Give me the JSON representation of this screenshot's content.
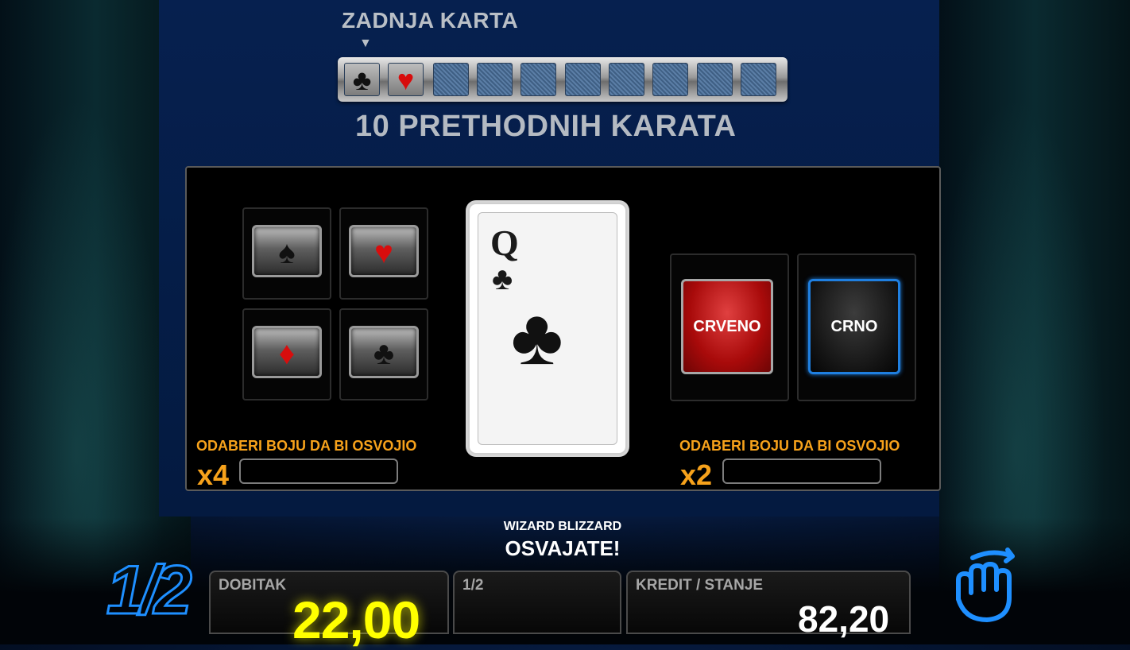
{
  "header": {
    "last_card_label": "ZADNJA KARTA",
    "arrow": "▼",
    "prev_cards_label": "10 PRETHODNIH KARATA"
  },
  "history": [
    {
      "state": "filled",
      "suit": "clubs",
      "glyph": "♣",
      "color": "#111111"
    },
    {
      "state": "filled",
      "suit": "hearts",
      "glyph": "♥",
      "color": "#d80d0d"
    },
    {
      "state": "empty"
    },
    {
      "state": "empty"
    },
    {
      "state": "empty"
    },
    {
      "state": "empty"
    },
    {
      "state": "empty"
    },
    {
      "state": "empty"
    },
    {
      "state": "empty"
    },
    {
      "state": "empty"
    }
  ],
  "suit_buttons": [
    {
      "name": "spade",
      "glyph": "♠",
      "color": "black"
    },
    {
      "name": "heart",
      "glyph": "♥",
      "color": "red"
    },
    {
      "name": "diamond",
      "glyph": "♦",
      "color": "red"
    },
    {
      "name": "club",
      "glyph": "♣",
      "color": "black"
    }
  ],
  "current_card": {
    "rank": "Q",
    "suit_glyph": "♣",
    "suit": "clubs"
  },
  "color_buttons": {
    "red_label": "CRVENO",
    "black_label": "CRNO"
  },
  "suit_section": {
    "hint": "ODABERI BOJU DA BI OSVOJIO",
    "multiplier": "x4"
  },
  "color_section": {
    "hint": "ODABERI BOJU DA BI OSVOJIO",
    "multiplier": "x2"
  },
  "game": {
    "name": "WIZARD BLIZZARD",
    "status": "OSVAJATE!"
  },
  "bottom": {
    "half_icon": "1/2",
    "win_label": "DOBITAK",
    "win_value": "22,00",
    "half_label": "1/2",
    "credit_label": "KREDIT / STANJE",
    "credit_value": "82,20"
  },
  "icons": {
    "take_win": "hand-icon",
    "half_gamble": "half-icon"
  },
  "colors": {
    "accent_blue": "#1e8fff",
    "hint_orange": "#f7a21b",
    "win_yellow": "#ffff00"
  }
}
